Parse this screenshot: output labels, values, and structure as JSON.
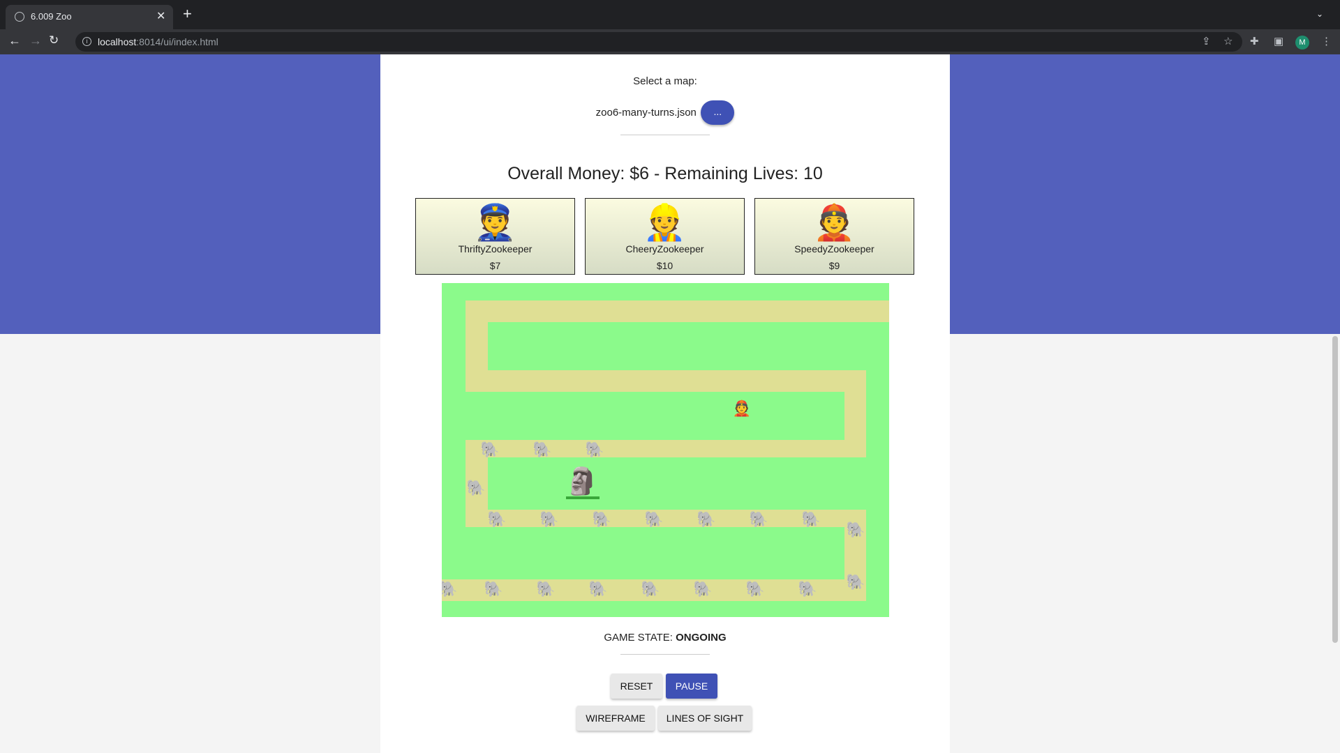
{
  "browser": {
    "tab_title": "6.009 Zoo",
    "tab_close": "✕",
    "new_tab": "+",
    "tab_search": "⌄",
    "url_host": "localhost",
    "url_path": ":8014/ui/index.html",
    "avatar_letter": "M"
  },
  "map_select": {
    "label": "Select a map:",
    "filename": "zoo6-many-turns.json",
    "browse_label": "..."
  },
  "status": {
    "text": "Overall Money: $6 - Remaining Lives: 10"
  },
  "zookeepers": [
    {
      "name": "ThriftyZookeeper",
      "price": "$7",
      "emoji": "👮"
    },
    {
      "name": "CheeryZookeeper",
      "price": "$10",
      "emoji": "👷"
    },
    {
      "name": "SpeedyZookeeper",
      "price": "$9",
      "emoji": "👲"
    }
  ],
  "game": {
    "placed_keeper_emoji": "👲",
    "elephant_emoji": "🐘",
    "rock_emoji": "🗿",
    "state_label": "GAME STATE:",
    "state_value": "ONGOING"
  },
  "buttons": {
    "reset": "RESET",
    "pause": "PAUSE",
    "wireframe": "WIREFRAME",
    "lines_of_sight": "LINES OF SIGHT"
  },
  "colors": {
    "accent": "#3f51b5",
    "hero": "#5360bc",
    "grass": "#8bfa8b",
    "path": "#dfdf94"
  }
}
